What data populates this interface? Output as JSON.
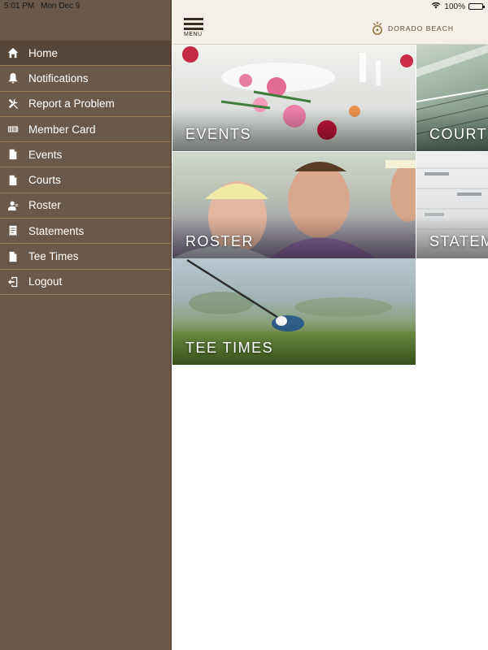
{
  "status_bar": {
    "time": "5:01 PM",
    "date": "Mon Dec 9",
    "battery": "100%"
  },
  "header": {
    "menu_label": "MENU",
    "brand": "DORADO BEACH"
  },
  "sidebar": {
    "items": [
      {
        "label": "Home",
        "icon": "home-icon",
        "active": true
      },
      {
        "label": "Notifications",
        "icon": "bell-icon"
      },
      {
        "label": "Report a Problem",
        "icon": "tools-icon"
      },
      {
        "label": "Member Card",
        "icon": "barcode-icon"
      },
      {
        "label": "Events",
        "icon": "document-icon"
      },
      {
        "label": "Courts",
        "icon": "document-icon"
      },
      {
        "label": "Roster",
        "icon": "person-icon"
      },
      {
        "label": "Statements",
        "icon": "receipt-icon"
      },
      {
        "label": "Tee Times",
        "icon": "document-icon"
      },
      {
        "label": "Logout",
        "icon": "logout-icon"
      }
    ]
  },
  "tiles": {
    "events": "EVENTS",
    "courts": "COURTS",
    "roster": "ROSTER",
    "statements": "STATEMENTS",
    "tee_times": "TEE TIMES"
  },
  "colors": {
    "sidebar": "#6b5849",
    "sidebar_active": "#574538",
    "divider": "#9a7858",
    "header": "#f4efe7"
  }
}
